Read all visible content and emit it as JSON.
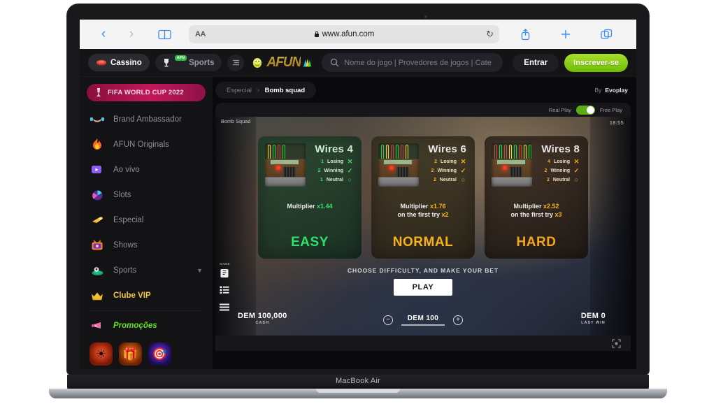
{
  "device": {
    "label": "MacBook Air"
  },
  "browser": {
    "back_icon": "chevron-left-icon",
    "forward_icon": "chevron-right-icon",
    "reader_icon": "book-icon",
    "text_size_label": "AA",
    "lock_icon": "lock-icon",
    "url": "www.afun.com",
    "reload_icon": "reload-icon",
    "share_icon": "share-icon",
    "new_tab_icon": "plus-icon",
    "tabs_icon": "tabs-icon"
  },
  "header": {
    "tabs": [
      {
        "label": "Cassino",
        "icon": "casino-chips-icon",
        "active": true,
        "badge": ""
      },
      {
        "label": "Sports",
        "icon": "trophy-icon",
        "active": false,
        "badge": "AFN"
      }
    ],
    "menu_icon": "hamburger-icon",
    "logo_text": "AFUN",
    "search": {
      "icon": "search-icon",
      "placeholder": "Nome do jogo | Provedores de jogos | Cate",
      "value": ""
    },
    "login_label": "Entrar",
    "signup_label": "Inscrever-se"
  },
  "sidebar": {
    "banner": {
      "label": "FIFA WORLD CUP 2022",
      "icon": "world-cup-trophy-icon"
    },
    "items": [
      {
        "label": "Brand Ambassador",
        "icon": "handshake-icon",
        "style": "normal",
        "chevron": false
      },
      {
        "label": "AFUN Originals",
        "icon": "fire-icon",
        "style": "normal",
        "chevron": false
      },
      {
        "label": "Ao vivo",
        "icon": "live-video-icon",
        "style": "normal",
        "chevron": false
      },
      {
        "label": "Slots",
        "icon": "slots-icon",
        "style": "normal",
        "chevron": false
      },
      {
        "label": "Especial",
        "icon": "rocket-icon",
        "style": "normal",
        "chevron": false
      },
      {
        "label": "Shows",
        "icon": "tv-icon",
        "style": "normal",
        "chevron": false
      },
      {
        "label": "Sports",
        "icon": "stadium-icon",
        "style": "normal",
        "chevron": true
      },
      {
        "label": "Clube VIP",
        "icon": "crown-icon",
        "style": "gold",
        "chevron": false
      },
      {
        "label": "Promoções",
        "icon": "megaphone-icon",
        "style": "promo",
        "chevron": false
      }
    ],
    "tiles": [
      {
        "icon": "bonus-wheel-icon",
        "locked": false
      },
      {
        "icon": "gift-box-icon",
        "locked": false
      },
      {
        "icon": "target-icon",
        "locked": false
      },
      {
        "icon": "locked-tile-icon",
        "locked": true
      },
      {
        "icon": "locked-tile-icon",
        "locked": true
      },
      {
        "icon": "locked-tile-icon",
        "locked": false
      }
    ]
  },
  "breadcrumb": {
    "category": "Especial",
    "separator": ">",
    "game": "Bomb squad",
    "by_label": "By",
    "provider": "Evoplay"
  },
  "game_panel": {
    "mode_left": "Real Play",
    "mode_right": "Free Play",
    "toggle_state": "free",
    "frame_title": "Bomb Squad",
    "clock": "18:55",
    "expand_icon": "fullscreen-icon",
    "side_tools": {
      "label": "GAME",
      "items": [
        {
          "icon": "rules-icon"
        },
        {
          "icon": "paytable-icon"
        },
        {
          "icon": "menu-icon"
        }
      ]
    },
    "cards": [
      {
        "id": "easy",
        "wires_title": "Wires 4",
        "stats": [
          {
            "count": "1",
            "label": "Losing",
            "mark": "✕"
          },
          {
            "count": "2",
            "label": "Winning",
            "mark": "✓"
          },
          {
            "count": "1",
            "label": "Neutral",
            "mark": "○"
          }
        ],
        "multiplier_label": "Multiplier",
        "multiplier_value": "x1.44",
        "first_try_label": "",
        "first_try_value": "",
        "difficulty": "EASY",
        "bomb_icon": "bomb-device-icon"
      },
      {
        "id": "normal",
        "wires_title": "Wires 6",
        "stats": [
          {
            "count": "2",
            "label": "Losing",
            "mark": "✕"
          },
          {
            "count": "2",
            "label": "Winning",
            "mark": "✓"
          },
          {
            "count": "2",
            "label": "Neutral",
            "mark": "○"
          }
        ],
        "multiplier_label": "Multiplier",
        "multiplier_value": "x1.76",
        "first_try_label": "on the first try",
        "first_try_value": "x2",
        "difficulty": "NORMAL",
        "bomb_icon": "bomb-device-icon"
      },
      {
        "id": "hard",
        "wires_title": "Wires 8",
        "stats": [
          {
            "count": "4",
            "label": "Losing",
            "mark": "✕"
          },
          {
            "count": "2",
            "label": "Winning",
            "mark": "✓"
          },
          {
            "count": "2",
            "label": "Neutral",
            "mark": "○"
          }
        ],
        "multiplier_label": "Multiplier",
        "multiplier_value": "x2.52",
        "first_try_label": "on the first try",
        "first_try_value": "x3",
        "difficulty": "HARD",
        "bomb_icon": "bomb-device-icon"
      }
    ],
    "prompt": "CHOOSE DIFFICULTY, AND MAKE YOUR BET",
    "play_label": "PLAY",
    "balance": {
      "amount": "DEM 100,000",
      "label": "CASH"
    },
    "bet": {
      "value": "DEM 100",
      "minus_icon": "minus-circle-icon",
      "plus_icon": "plus-circle-icon"
    },
    "last_win": {
      "amount": "DEM 0",
      "label": "LAST WIN"
    }
  },
  "colors": {
    "accent_green": "#63e21a",
    "signup_green": "#6fbd04",
    "gold": "#f2c43a",
    "easy_green": "#2fe06a",
    "difficulty_gold": "#f5b21a",
    "fifa_pink": "#c2185b"
  }
}
